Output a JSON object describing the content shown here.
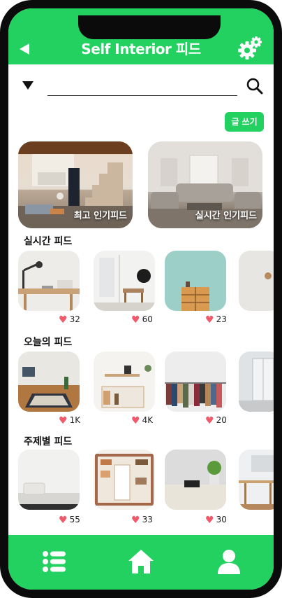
{
  "header": {
    "title": "Self Interior 피드"
  },
  "search": {
    "placeholder": ""
  },
  "write_button": "글 쓰기",
  "features": [
    {
      "label": "최고 인기피드"
    },
    {
      "label": "실시간 인기피드"
    }
  ],
  "sections": [
    {
      "title": "실시간 피드",
      "likes": [
        "32",
        "60",
        "23"
      ]
    },
    {
      "title": "오늘의 피드",
      "likes": [
        "1K",
        "4K",
        "20"
      ]
    },
    {
      "title": "주제별 피드",
      "likes": [
        "55",
        "33",
        "30"
      ]
    }
  ],
  "colors": {
    "accent": "#22d160",
    "heart": "#ef5b6a"
  },
  "icons": {
    "back": "back-arrow-icon",
    "settings": "gear-icon",
    "dropdown": "dropdown-triangle-icon",
    "search": "search-icon",
    "like": "heart-icon",
    "nav": [
      "list-icon",
      "home-icon",
      "profile-icon"
    ]
  }
}
